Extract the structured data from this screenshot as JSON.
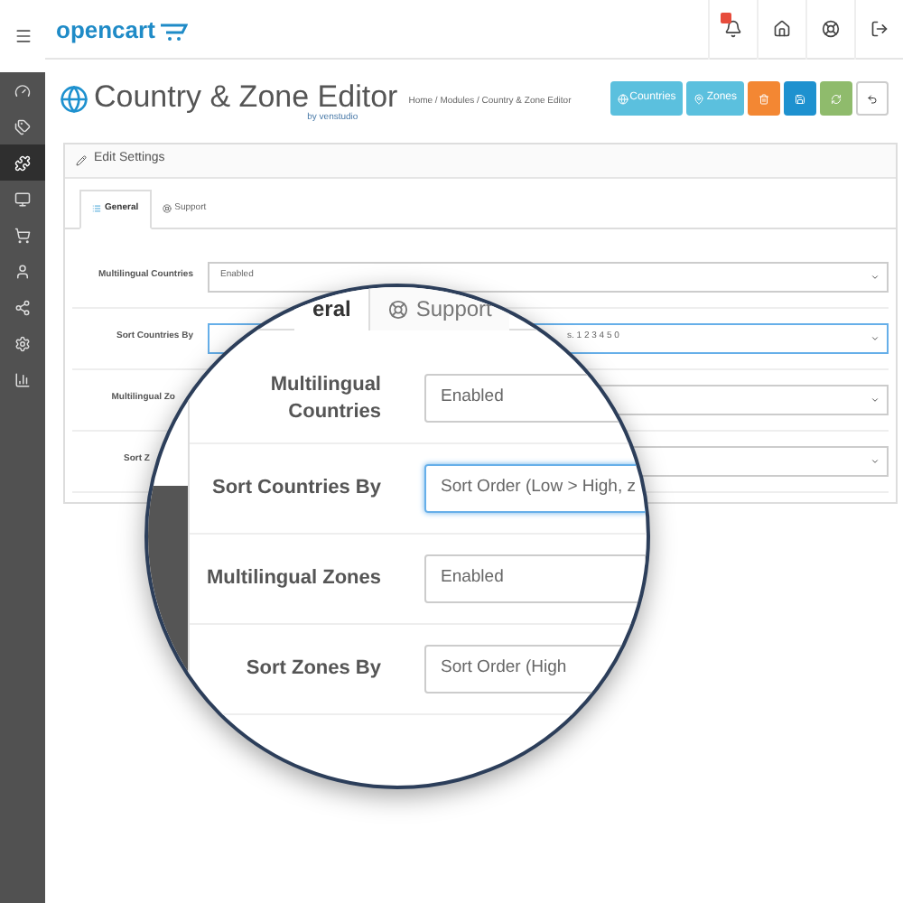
{
  "header": {
    "logo": "opencart",
    "icons": [
      {
        "kind": "bell",
        "badge": true
      },
      {
        "kind": "home",
        "badge": false
      },
      {
        "kind": "help",
        "badge": false
      },
      {
        "kind": "logout",
        "badge": false
      }
    ]
  },
  "sidebar": {
    "items": [
      {
        "kind": "dashboard",
        "selected": false
      },
      {
        "kind": "tags",
        "selected": false
      },
      {
        "kind": "puzzle",
        "selected": true
      },
      {
        "kind": "monitor",
        "selected": false
      },
      {
        "kind": "cart",
        "selected": false
      },
      {
        "kind": "user",
        "selected": false
      },
      {
        "kind": "share",
        "selected": false
      },
      {
        "kind": "gear",
        "selected": false
      },
      {
        "kind": "chart",
        "selected": false
      }
    ]
  },
  "page": {
    "title": "Country & Zone Editor",
    "byline": "by venstudio",
    "breadcrumb": "Home / Modules / Country & Zone Editor",
    "buttons": [
      {
        "kind": "countries",
        "label": "Countries"
      },
      {
        "kind": "zones",
        "label": "Zones"
      },
      {
        "kind": "delete"
      },
      {
        "kind": "save"
      },
      {
        "kind": "refresh"
      },
      {
        "kind": "back"
      }
    ]
  },
  "panel": {
    "title": "Edit Settings",
    "tabs": [
      {
        "kind": "general",
        "label": "General",
        "selected": true
      },
      {
        "kind": "support",
        "label": "Support",
        "selected": false
      }
    ],
    "rows": [
      {
        "label": "Multilingual Countries",
        "value": "Enabled",
        "focused": false
      },
      {
        "label": "Sort Countries By",
        "value": "s. 1 2 3 4 5 0",
        "focused": true
      },
      {
        "label": "Multilingual Zo",
        "focused": false
      },
      {
        "label": "Sort Z",
        "focused": false
      }
    ]
  },
  "magnifier": {
    "tabs": [
      {
        "kind": "general",
        "label": "eral",
        "selected": true
      },
      {
        "kind": "support",
        "label": "Support",
        "selected": false
      }
    ],
    "rows": [
      {
        "label": "Multilingual Countries",
        "value": "Enabled",
        "focused": false
      },
      {
        "label": "Sort Countries By",
        "value": "Sort Order (Low > High, z",
        "focused": true
      },
      {
        "label": "Multilingual Zones",
        "value": "Enabled",
        "focused": false
      },
      {
        "label": "Sort Zones By",
        "value": "Sort Order (High",
        "focused": false
      }
    ]
  }
}
